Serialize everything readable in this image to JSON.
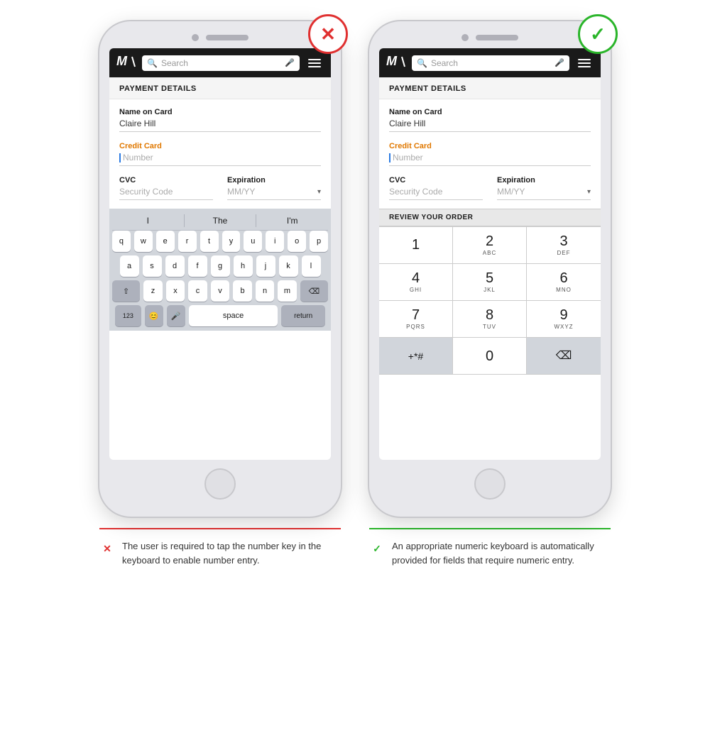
{
  "phones": [
    {
      "id": "bad",
      "badge_type": "bad",
      "badge_symbol": "✕",
      "header": {
        "logo": "M",
        "search_placeholder": "Search",
        "mic_icon": "🎤",
        "hamburger": true
      },
      "payment": {
        "title": "PAYMENT DETAILS",
        "name_on_card_label": "Name on Card",
        "name_on_card_value": "Claire Hill",
        "credit_card_label": "Credit Card",
        "credit_card_label_sub": "",
        "credit_card_placeholder": "Number",
        "cvc_label": "CVC",
        "cvc_placeholder": "Security Code",
        "expiration_label": "Expiration",
        "expiration_placeholder": "MM/YY"
      },
      "keyboard_type": "alpha",
      "autocomplete": [
        "I",
        "The",
        "I'm"
      ],
      "alpha_rows": [
        [
          "q",
          "w",
          "e",
          "r",
          "t",
          "y",
          "u",
          "i",
          "o",
          "p"
        ],
        [
          "a",
          "s",
          "d",
          "f",
          "g",
          "h",
          "j",
          "k",
          "l"
        ],
        [
          "⇧",
          "z",
          "x",
          "c",
          "v",
          "b",
          "n",
          "m",
          "⌫"
        ],
        [
          "123",
          "😊",
          "🎤",
          "space",
          "return"
        ]
      ]
    },
    {
      "id": "good",
      "badge_type": "good",
      "badge_symbol": "✓",
      "header": {
        "logo": "M",
        "search_placeholder": "Search",
        "mic_icon": "🎤",
        "hamburger": true
      },
      "payment": {
        "title": "PAYMENT DETAILS",
        "name_on_card_label": "Name on Card",
        "name_on_card_value": "Claire Hill",
        "credit_card_label": "Credit Card",
        "credit_card_placeholder": "Number",
        "cvc_label": "CVC",
        "cvc_placeholder": "Security Code",
        "expiration_label": "Expiration",
        "expiration_placeholder": "MM/YY"
      },
      "keyboard_type": "numeric",
      "review_banner": "REVIEW YOUR ORDER",
      "numpad": [
        {
          "num": "1",
          "sub": ""
        },
        {
          "num": "2",
          "sub": "ABC"
        },
        {
          "num": "3",
          "sub": "DEF"
        },
        {
          "num": "4",
          "sub": "GHI"
        },
        {
          "num": "5",
          "sub": "JKL"
        },
        {
          "num": "6",
          "sub": "MNO"
        },
        {
          "num": "7",
          "sub": "PQRS"
        },
        {
          "num": "8",
          "sub": "TUV"
        },
        {
          "num": "9",
          "sub": "WXYZ"
        },
        {
          "num": "+*#",
          "sub": ""
        },
        {
          "num": "0",
          "sub": ""
        },
        {
          "num": "⌫",
          "sub": ""
        }
      ]
    }
  ],
  "captions": [
    {
      "type": "bad",
      "symbol": "✕",
      "text": "The user is required to tap the number key in the keyboard to enable number entry."
    },
    {
      "type": "good",
      "symbol": "✓",
      "text": "An appropriate numeric keyboard is automatically provided for fields that require numeric entry."
    }
  ]
}
